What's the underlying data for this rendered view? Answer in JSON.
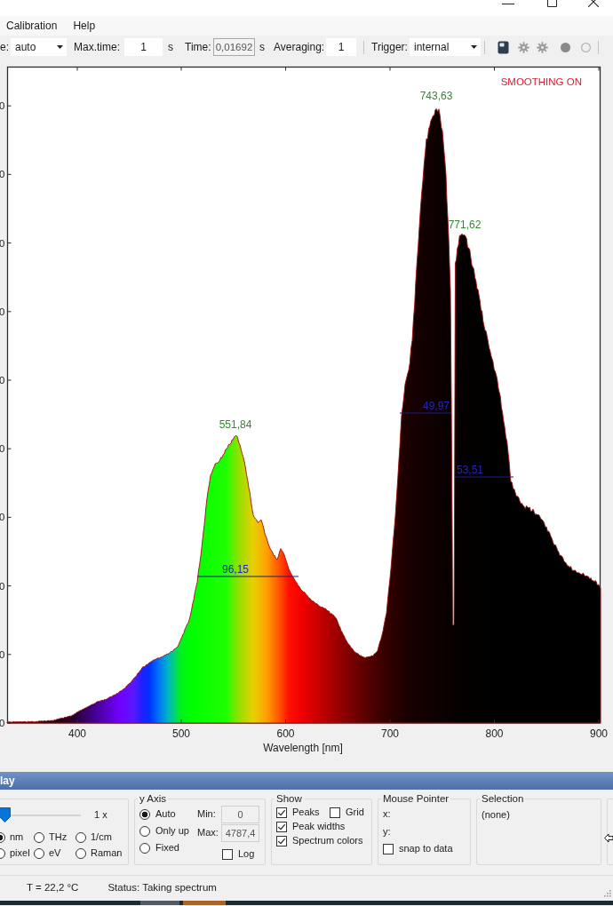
{
  "window": {
    "menu": [
      {
        "label": "Calibration"
      },
      {
        "label": "Help"
      }
    ]
  },
  "toolbar": [
    {
      "kind": "label",
      "text": "e:"
    },
    {
      "kind": "dropdown",
      "value": "auto"
    },
    {
      "kind": "label",
      "text": "Max.time:"
    },
    {
      "kind": "input",
      "value": "1",
      "disabled": false
    },
    {
      "kind": "unit",
      "text": "s"
    },
    {
      "kind": "label",
      "text": "Time:"
    },
    {
      "kind": "input",
      "value": "0,01692",
      "disabled": true
    },
    {
      "kind": "unit",
      "text": "s"
    },
    {
      "kind": "label",
      "text": "Averaging:"
    },
    {
      "kind": "input",
      "value": "1",
      "disabled": false
    },
    {
      "kind": "separator"
    },
    {
      "kind": "label",
      "text": "Trigger:"
    },
    {
      "kind": "dropdown",
      "value": "internal"
    },
    {
      "kind": "separator"
    },
    {
      "kind": "button",
      "disabled": false
    },
    {
      "kind": "button",
      "disabled": true
    },
    {
      "kind": "button",
      "disabled": true
    },
    {
      "kind": "button",
      "disabled": true
    },
    {
      "kind": "button",
      "disabled": true
    },
    {
      "kind": "separator"
    }
  ],
  "chart": {
    "indicator": "SMOOTHING ON",
    "y_tick_labels": [
      "0",
      "0",
      "0",
      "0",
      "0",
      "0",
      "0",
      "0",
      "0",
      "0"
    ],
    "x_tick_labels": [
      "400",
      "500",
      "600",
      "700",
      "800",
      "900"
    ],
    "xlabel": "Wavelength [nm]",
    "peaks": [
      {
        "label": "551,84"
      },
      {
        "label": "743,63"
      },
      {
        "label": "771,62"
      }
    ],
    "peak_widths": [
      {
        "label": "96,15"
      },
      {
        "label": "49,97"
      },
      {
        "label": "53,51"
      }
    ]
  },
  "display_panel": {
    "title": "lay",
    "zoom": {
      "level": 0,
      "reading": "1 x"
    },
    "x_units": [
      {
        "label": "nm",
        "selected": true
      },
      {
        "label": "THz",
        "selected": false
      },
      {
        "label": "1/cm",
        "selected": false
      },
      {
        "label": "pixel",
        "selected": false
      },
      {
        "label": "eV",
        "selected": false
      },
      {
        "label": "Raman",
        "selected": false
      }
    ],
    "y_axis": {
      "title": "y Axis",
      "modes": [
        {
          "label": "Auto",
          "selected": true
        },
        {
          "label": "Only up",
          "selected": false
        },
        {
          "label": "Fixed",
          "selected": false
        }
      ],
      "min": {
        "label": "Min:",
        "value": "0",
        "disabled": true
      },
      "max": {
        "label": "Max:",
        "value": "4787,4",
        "disabled": true
      },
      "log": {
        "label": "Log",
        "checked": false
      }
    },
    "show": {
      "title": "Show",
      "options": [
        {
          "label": "Peaks",
          "checked": true
        },
        {
          "label": "Grid",
          "checked": false
        },
        {
          "label": "Peak widths",
          "checked": true
        },
        {
          "label": "Spectrum colors",
          "checked": true
        }
      ]
    },
    "mouse_pointer": {
      "title": "Mouse Pointer",
      "x_label": "x:",
      "y_label": "y:",
      "snap": {
        "label": "snap to data",
        "checked": false
      }
    },
    "selection": {
      "title": "Selection",
      "value": "(none)"
    }
  },
  "status_bar": {
    "temperature": "T = 22,2 °C",
    "status": "Status: Taking spectrum"
  }
}
